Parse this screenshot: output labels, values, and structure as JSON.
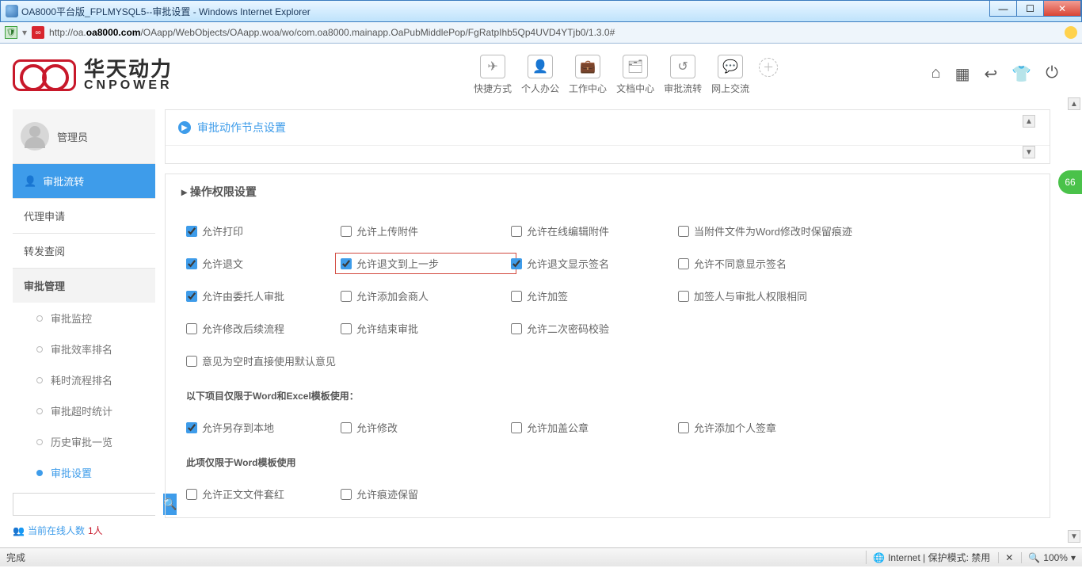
{
  "window": {
    "title": "OA8000平台版_FPLMYSQL5--审批设置 - Windows Internet Explorer"
  },
  "address": {
    "prefix": "http://oa.",
    "host": "oa8000.com",
    "path": "/OAapp/WebObjects/OAapp.woa/wo/com.oa8000.mainapp.OaPubMiddlePop/FgRatpIhb5Qp4UVD4YTjb0/1.3.0#"
  },
  "logo": {
    "cn": "华天动力",
    "en": "CNPOWER"
  },
  "topnav": [
    {
      "icon": "✈",
      "label": "快捷方式"
    },
    {
      "icon": "👤",
      "label": "个人办公"
    },
    {
      "icon": "💼",
      "label": "工作中心"
    },
    {
      "icon": "🗂",
      "label": "文档中心"
    },
    {
      "icon": "↺",
      "label": "审批流转"
    },
    {
      "icon": "💬",
      "label": "网上交流"
    }
  ],
  "sidebar": {
    "user": "管理员",
    "active": "审批流转",
    "items": [
      "代理申请",
      "转发查阅"
    ],
    "section": "审批管理",
    "subitems": [
      "审批监控",
      "审批效率排名",
      "耗时流程排名",
      "审批超时统计",
      "历史审批一览",
      "审批设置"
    ],
    "current_sub": "审批设置",
    "online_label": "当前在线人数",
    "online_count": "1人"
  },
  "panel": {
    "title": "审批动作节点设置",
    "section_title": "操作权限设置",
    "row1": [
      "允许打印",
      "允许上传附件",
      "允许在线编辑附件",
      "当附件文件为Word修改时保留痕迹"
    ],
    "row1_checked": [
      true,
      false,
      false,
      false
    ],
    "row2": [
      "允许退文",
      "允许退文到上一步",
      "允许退文显示签名",
      "允许不同意显示签名"
    ],
    "row2_checked": [
      true,
      true,
      true,
      false
    ],
    "row3": [
      "允许由委托人审批",
      "允许添加会商人",
      "允许加签",
      "加签人与审批人权限相同"
    ],
    "row3_checked": [
      true,
      false,
      false,
      false
    ],
    "row4": [
      "允许修改后续流程",
      "允许结束审批",
      "允许二次密码校验",
      ""
    ],
    "row4_checked": [
      false,
      false,
      false,
      false
    ],
    "row5_span": "意见为空时直接使用默认意见",
    "sub1": "以下项目仅限于Word和Excel模板使用：",
    "row6": [
      "允许另存到本地",
      "允许修改",
      "允许加盖公章",
      "允许添加个人签章"
    ],
    "row6_checked": [
      true,
      false,
      false,
      false
    ],
    "sub2": "此项仅限于Word模板使用",
    "row7": [
      "允许正文文件套红",
      "允许痕迹保留",
      "",
      ""
    ],
    "row7_checked": [
      false,
      false,
      false,
      false
    ]
  },
  "status": {
    "left": "完成",
    "mode": "Internet | 保护模式: 禁用",
    "zoom": "100%"
  },
  "badge": "66"
}
